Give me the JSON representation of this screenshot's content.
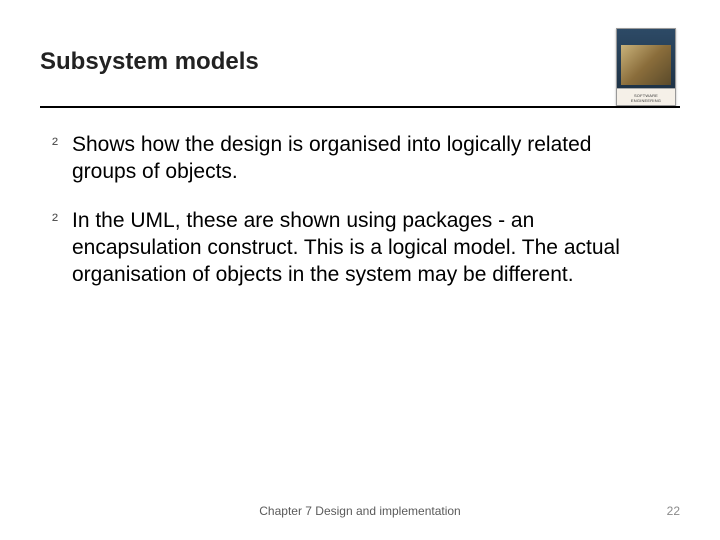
{
  "title": "Subsystem models",
  "book_spine": "SOFTWARE ENGINEERING",
  "bullets": [
    "Shows how the design is organised into logically related groups of objects.",
    "In the UML, these are shown using packages - an encapsulation construct. This is a logical model. The actual organisation of objects in the system may be different."
  ],
  "footer_center": "Chapter 7 Design and implementation",
  "page_number": "22",
  "marker": "²"
}
